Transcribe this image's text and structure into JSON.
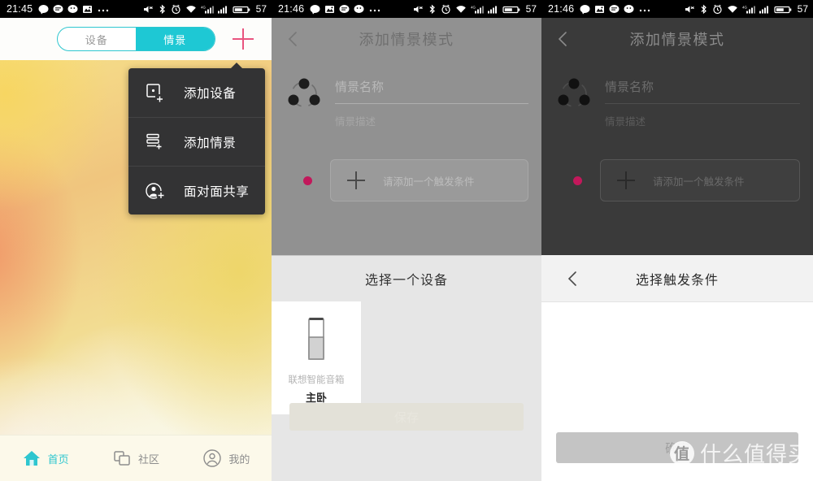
{
  "panels": [
    {
      "statusbar": {
        "time": "21:45",
        "battery": "57",
        "left_icons": [
          "chat-bubble-icon",
          "message-icon",
          "wechat-icon",
          "photo-icon",
          "more-dots-icon"
        ],
        "right_icons": [
          "mute-icon",
          "bluetooth-icon",
          "alarm-icon",
          "wifi-icon",
          "signal-1-icon",
          "signal-2-icon",
          "battery-icon"
        ]
      },
      "segmented": {
        "tab_devices": "设备",
        "tab_scenes": "情景",
        "active": "情景"
      },
      "add_button": "+",
      "menu": [
        {
          "icon": "add-device-icon",
          "label": "添加设备"
        },
        {
          "icon": "add-scene-icon",
          "label": "添加情景"
        },
        {
          "icon": "face-to-face-share-icon",
          "label": "面对面共享"
        }
      ],
      "bottom_nav": [
        {
          "icon": "home-icon",
          "label": "首页",
          "active": true
        },
        {
          "icon": "community-icon",
          "label": "社区",
          "active": false
        },
        {
          "icon": "profile-icon",
          "label": "我的",
          "active": false
        }
      ]
    },
    {
      "statusbar": {
        "time": "21:46",
        "battery": "57"
      },
      "navbar": {
        "back": "back-chevron-icon",
        "title": "添加情景模式"
      },
      "form": {
        "avatar_icon": "scene-share-icon",
        "name_placeholder": "情景名称",
        "desc_placeholder": "情景描述",
        "trigger_label": "请添加一个触发条件",
        "trigger_plus": "+"
      },
      "save_label": "保存",
      "sheet": {
        "title": "选择一个设备",
        "devices": [
          {
            "icon": "smart-speaker-icon",
            "brand": "联想智能音箱",
            "room": "主卧"
          }
        ]
      }
    },
    {
      "statusbar": {
        "time": "21:46",
        "battery": "57"
      },
      "navbar": {
        "back": "back-chevron-icon",
        "title": "添加情景模式"
      },
      "form": {
        "avatar_icon": "scene-share-icon",
        "name_placeholder": "情景名称",
        "desc_placeholder": "情景描述",
        "trigger_label": "请添加一个触发条件",
        "trigger_plus": "+"
      },
      "sheet": {
        "back": "back-chevron-icon",
        "title": "选择触发条件",
        "confirm_label": "确定"
      },
      "watermark": {
        "badge": "值",
        "text": "什么值得买"
      }
    }
  ],
  "colors": {
    "accent_teal": "#1ec8d4",
    "accent_pink": "#e9547f",
    "menu_bg": "#333334",
    "trigger_dot": "#c2185b"
  }
}
